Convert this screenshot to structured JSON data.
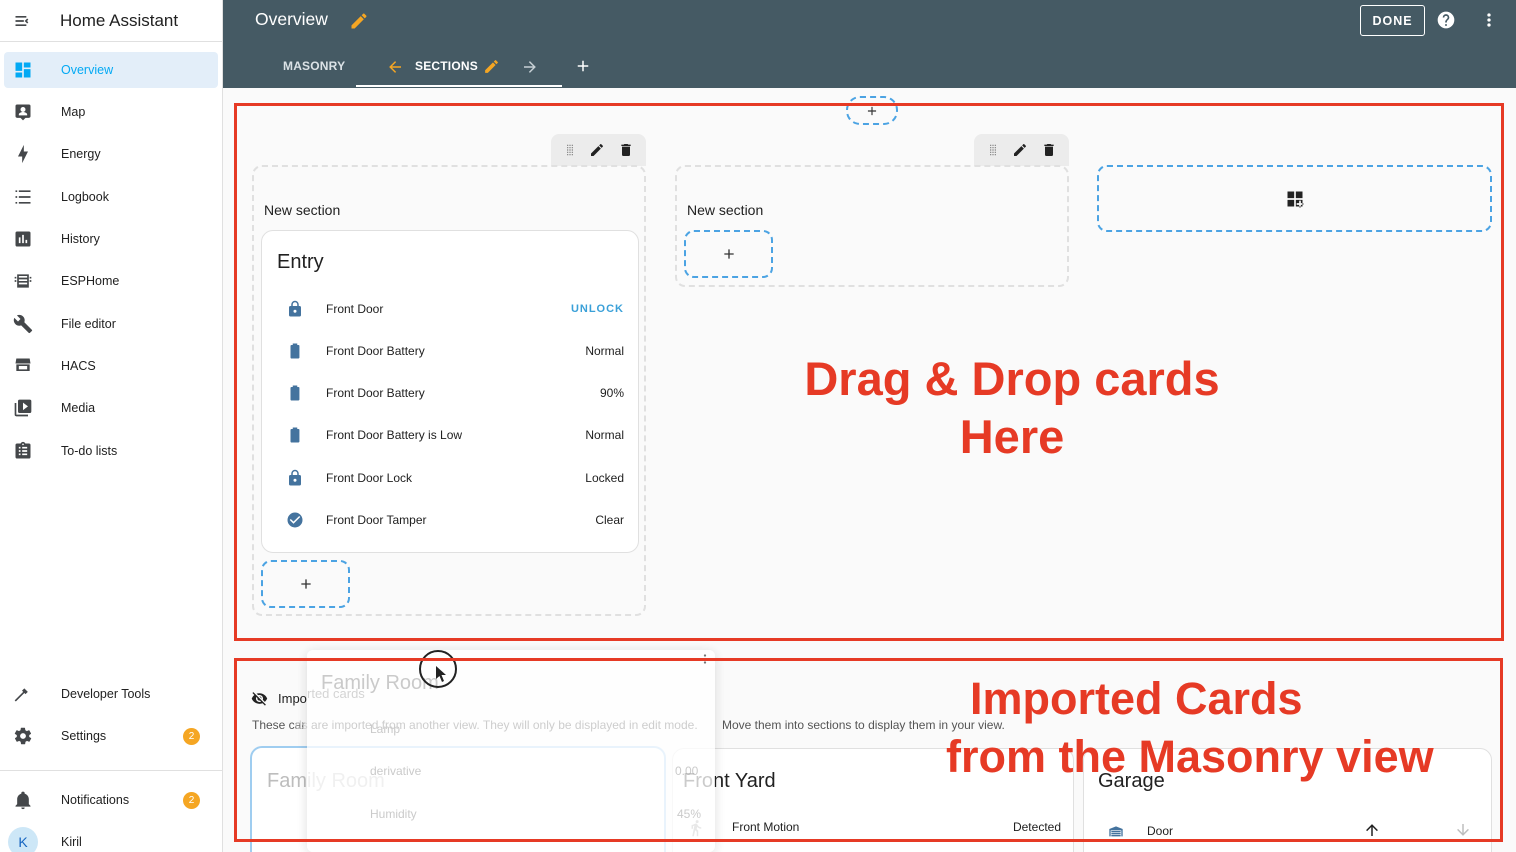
{
  "app": {
    "title": "Home Assistant"
  },
  "sidebar": {
    "items": [
      {
        "label": "Overview",
        "icon": "view-dashboard-icon",
        "active": true
      },
      {
        "label": "Map",
        "icon": "map-icon"
      },
      {
        "label": "Energy",
        "icon": "lightning-bolt-icon"
      },
      {
        "label": "Logbook",
        "icon": "list-icon"
      },
      {
        "label": "History",
        "icon": "chart-box-icon"
      },
      {
        "label": "ESPHome",
        "icon": "chip-icon"
      },
      {
        "label": "File editor",
        "icon": "wrench-icon"
      },
      {
        "label": "HACS",
        "icon": "hacs-icon"
      },
      {
        "label": "Media",
        "icon": "play-box-icon"
      },
      {
        "label": "To-do lists",
        "icon": "clipboard-list-icon"
      }
    ],
    "bottom": [
      {
        "label": "Developer Tools",
        "icon": "hammer-icon"
      },
      {
        "label": "Settings",
        "icon": "gear-icon",
        "badge": "2"
      }
    ],
    "notifications": {
      "label": "Notifications",
      "badge": "2"
    },
    "user": {
      "name": "Kiril",
      "initial": "K"
    }
  },
  "header": {
    "title": "Overview",
    "done_label": "DONE",
    "tabs": [
      {
        "label": "MASONRY"
      },
      {
        "label": "SECTIONS",
        "active": true
      }
    ]
  },
  "sections": [
    {
      "title": "New section",
      "card": {
        "title": "Entry",
        "rows": [
          {
            "icon": "lock-icon",
            "name": "Front Door",
            "value": "UNLOCK",
            "action": true
          },
          {
            "icon": "battery-icon",
            "name": "Front Door Battery",
            "value": "Normal"
          },
          {
            "icon": "battery-icon",
            "name": "Front Door Battery",
            "value": "90%"
          },
          {
            "icon": "battery-icon",
            "name": "Front Door Battery is Low",
            "value": "Normal"
          },
          {
            "icon": "lock-icon",
            "name": "Front Door Lock",
            "value": "Locked"
          },
          {
            "icon": "check-circle-icon",
            "name": "Front Door Tamper",
            "value": "Clear"
          }
        ]
      }
    },
    {
      "title": "New section"
    }
  ],
  "annotations": {
    "drag_drop_line1": "Drag & Drop cards",
    "drag_drop_line2": "Here",
    "imported_line1": "Imported Cards",
    "imported_line2": "from the Masonry view"
  },
  "imported": {
    "title_start": "Impo",
    "title_end": "rted cards",
    "desc_start": "These car",
    "desc_ghost": "ds are imported from another view. They will only be displayed in edit mode.",
    "desc_end": "Move them into sections to display them in your view.",
    "cards": [
      {
        "title": "Family Room"
      },
      {
        "title": "Front Yard",
        "row_name": "Front Motion",
        "row_value": "Detected"
      },
      {
        "title": "Garage",
        "row_name": "Door"
      }
    ],
    "ghost_card": {
      "title": "Family Room",
      "rows": [
        "Lamp",
        "derivative",
        "Humidity"
      ],
      "values": [
        "0.00",
        "45%"
      ]
    }
  }
}
